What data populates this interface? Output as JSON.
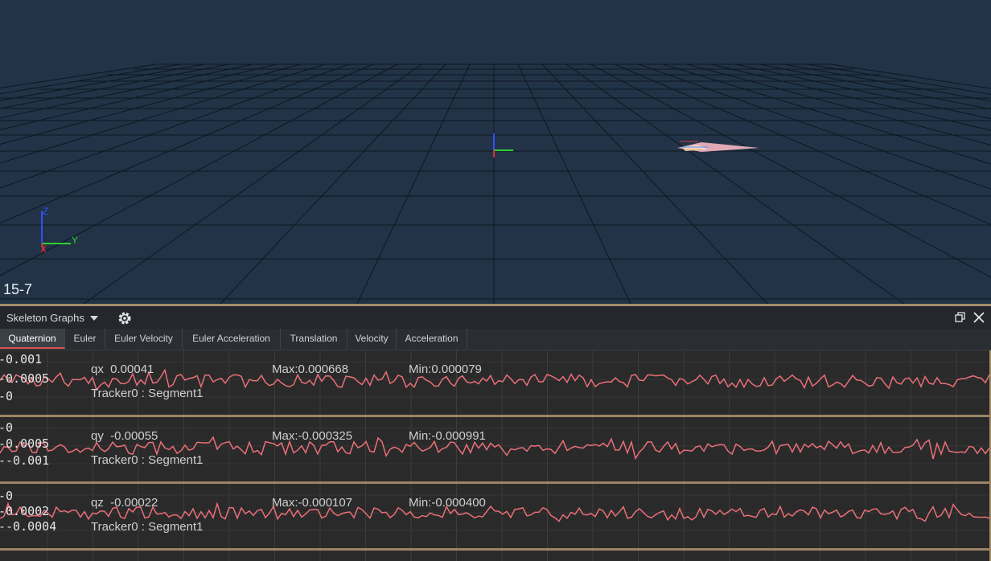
{
  "viewport": {
    "frame_label": "15-7",
    "axis_labels": {
      "x": "X",
      "y": "Y",
      "z": "Z"
    },
    "axis_colors": {
      "x": "#e03030",
      "y": "#30d030",
      "z": "#3050ff"
    },
    "background": "#223347",
    "grid_color": "#0d1722",
    "rigid_body_color": "#f4b6c2"
  },
  "panel": {
    "title": "Skeleton Graphs",
    "dropdown_icon": "chevron-down-icon",
    "settings_icon": "gear-icon",
    "restore_icon": "restore-window-icon",
    "close_icon": "close-icon"
  },
  "tabs": [
    {
      "label": "Quaternion",
      "active": true
    },
    {
      "label": "Euler",
      "active": false
    },
    {
      "label": "Euler Velocity",
      "active": false
    },
    {
      "label": "Euler Acceleration",
      "active": false
    },
    {
      "label": "Translation",
      "active": false
    },
    {
      "label": "Velocity",
      "active": false
    },
    {
      "label": "Acceleration",
      "active": false
    }
  ],
  "graphs": [
    {
      "channel": "qx  0.00041",
      "max": "Max:0.000668",
      "min": "Min:0.000079",
      "source": "Tracker0 : Segment1",
      "y_ticks": [
        "-0.001",
        "-0.0005",
        "-0"
      ],
      "line_color": "#ea6f78"
    },
    {
      "channel": "qy  -0.00055",
      "max": "Max:-0.000325",
      "min": "Min:-0.000991",
      "source": "Tracker0 : Segment1",
      "y_ticks": [
        "-0",
        "-0.0005",
        "--0.001"
      ],
      "line_color": "#ea6f78"
    },
    {
      "channel": "qz  -0.00022",
      "max": "Max:-0.000107",
      "min": "Min:-0.000400",
      "source": "Tracker0 : Segment1",
      "y_ticks": [
        "-0",
        "-0.0002",
        "--0.0004"
      ],
      "line_color": "#ea6f78"
    }
  ]
}
